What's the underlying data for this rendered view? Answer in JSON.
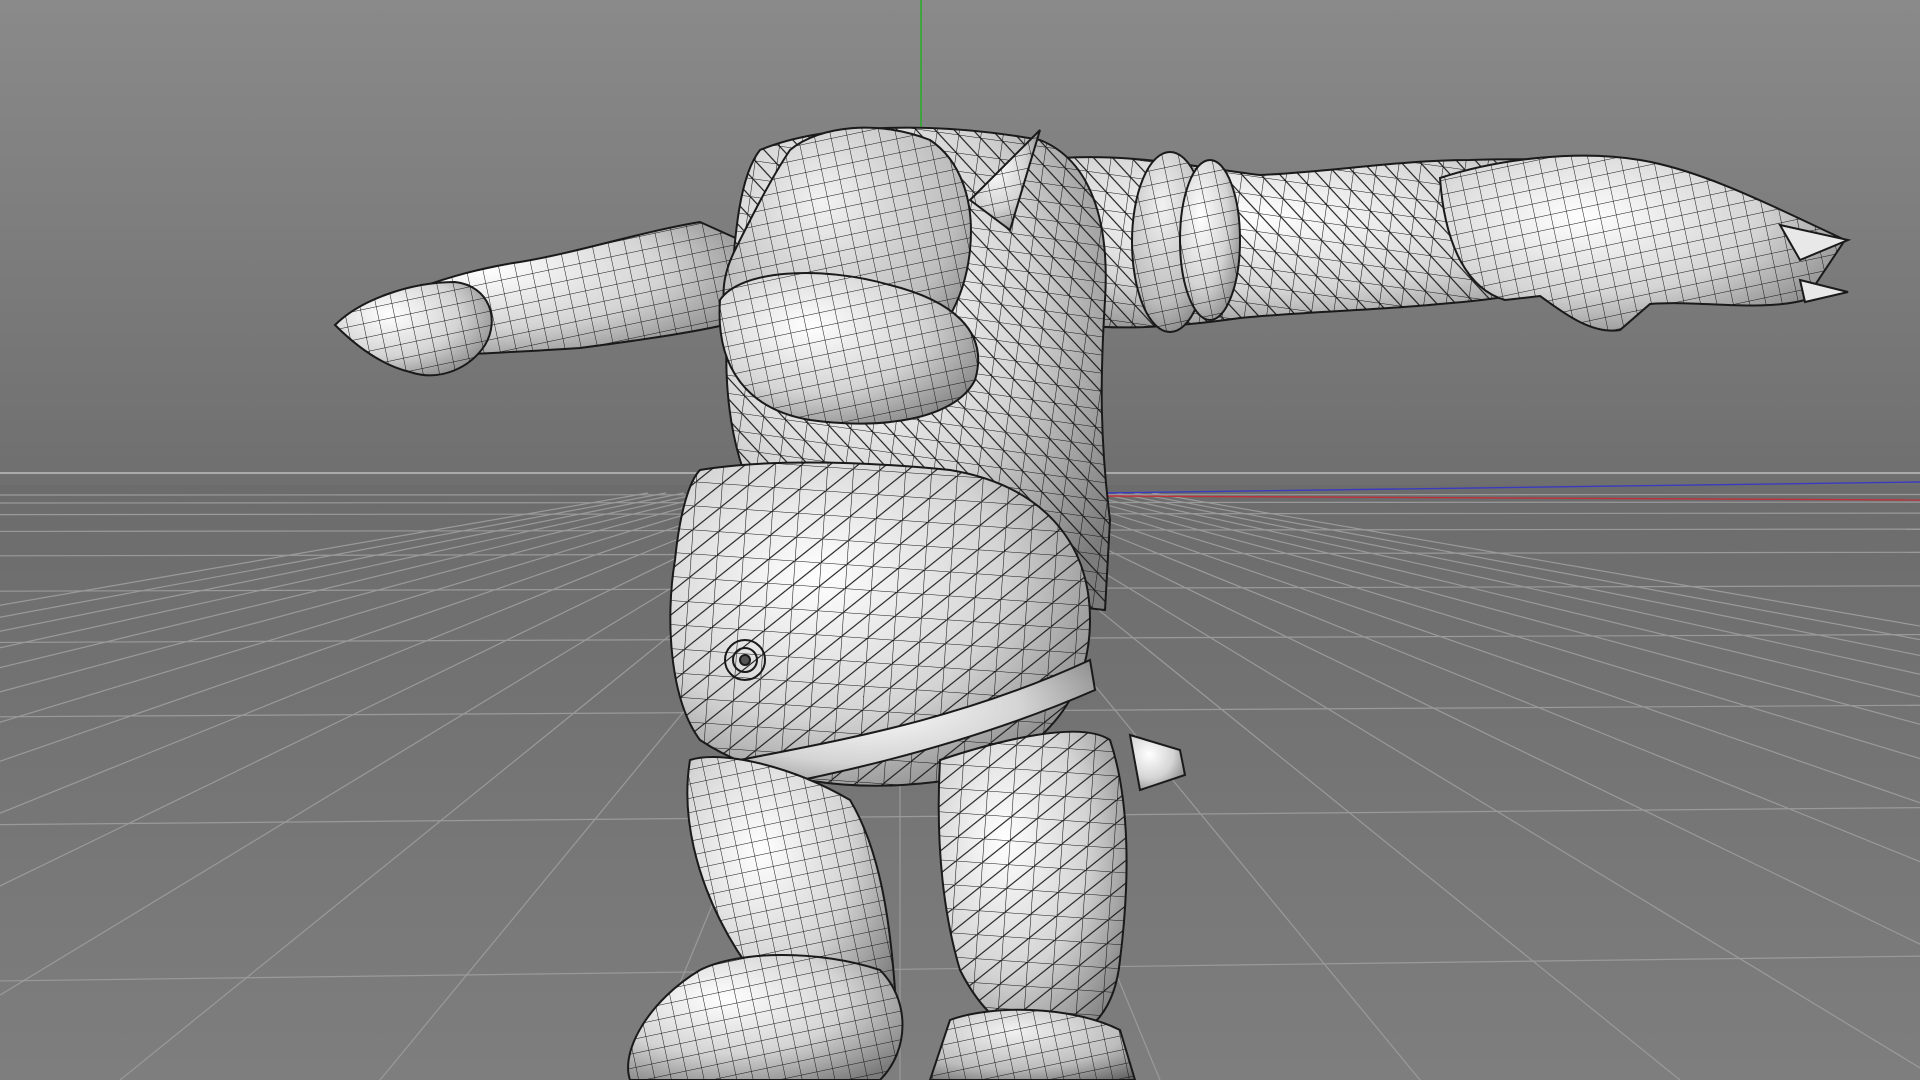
{
  "viewport": {
    "mode": "perspective",
    "display": "gouraud-shading-with-lines",
    "background_top": "#878787",
    "background_horizon": "#6e6e6e",
    "floor_color": "#747474",
    "grid_color": "#9a9a9a",
    "axis_x_color": "#c0303a",
    "axis_z_color": "#3a3ac0",
    "axis_y_color": "#20b020",
    "horizon_line_color": "#b8b8b8",
    "mesh_fill": "#dcdcdc",
    "mesh_wire": "#1a1a1a",
    "grid_visible": true
  },
  "model": {
    "icon": "character-mesh-icon",
    "pose": "t-pose"
  }
}
